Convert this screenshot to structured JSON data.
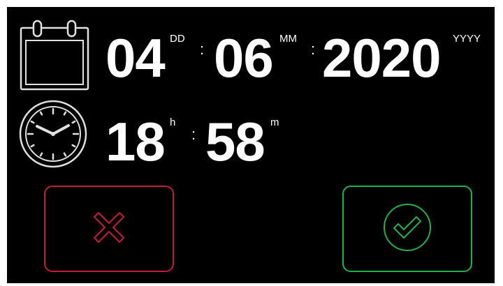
{
  "date": {
    "day": "04",
    "day_unit": "DD",
    "month": "06",
    "month_unit": "MM",
    "year": "2020",
    "year_unit": "YYYY",
    "separator": ":"
  },
  "time": {
    "hours": "18",
    "hours_unit": "h",
    "minutes": "58",
    "minutes_unit": "m",
    "separator": ":"
  },
  "icons": {
    "calendar": "calendar-icon",
    "clock": "clock-icon",
    "cancel": "x-icon",
    "confirm": "checkmark-circle-icon"
  },
  "colors": {
    "background": "#000000",
    "text": "#ffffff",
    "cancel": "#c01d3a",
    "confirm": "#21b04b"
  }
}
